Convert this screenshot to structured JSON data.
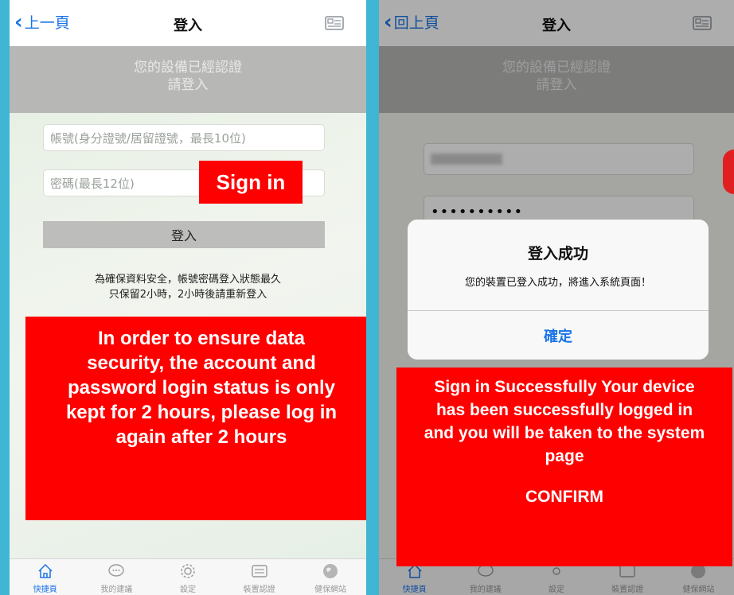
{
  "left": {
    "nav": {
      "back": "上一頁",
      "title": "登入"
    },
    "banner": {
      "line1": "您的設備已經認證",
      "line2": "請登入"
    },
    "account_placeholder": "帳號(身分證號/居留證號，最長10位)",
    "password_placeholder": "密碼(最長12位)",
    "login_button": "登入",
    "notice": {
      "line1": "為確保資料安全，帳號密碼登入狀態最久",
      "line2": "只保留2小時，2小時後請重新登入"
    },
    "annotation_signin": "Sign in",
    "annotation_notice": "In order to ensure data security, the account and password login status is only kept for 2 hours, please log in again after 2 hours"
  },
  "right": {
    "nav": {
      "back": "回上頁",
      "title": "登入"
    },
    "banner": {
      "line1": "您的設備已經認證",
      "line2": "請登入"
    },
    "password_value": "••••••••••",
    "dialog": {
      "title": "登入成功",
      "message": "您的裝置已登入成功，將進入系統頁面！",
      "confirm": "確定"
    },
    "annotation_success": "Sign in Successfully Your device has been successfully logged in and you will be taken to the system page",
    "annotation_confirm": "CONFIRM"
  },
  "tabs": [
    {
      "label": "快捷頁",
      "icon": "home-icon"
    },
    {
      "label": "我的建議",
      "icon": "chat-icon"
    },
    {
      "label": "設定",
      "icon": "gear-icon"
    },
    {
      "label": "裝置認證",
      "icon": "device-icon"
    },
    {
      "label": "健保網站",
      "icon": "globe-icon"
    }
  ],
  "colors": {
    "accent": "#1a73e8",
    "annotation": "#ff0000",
    "frame": "#3fb6d4"
  }
}
